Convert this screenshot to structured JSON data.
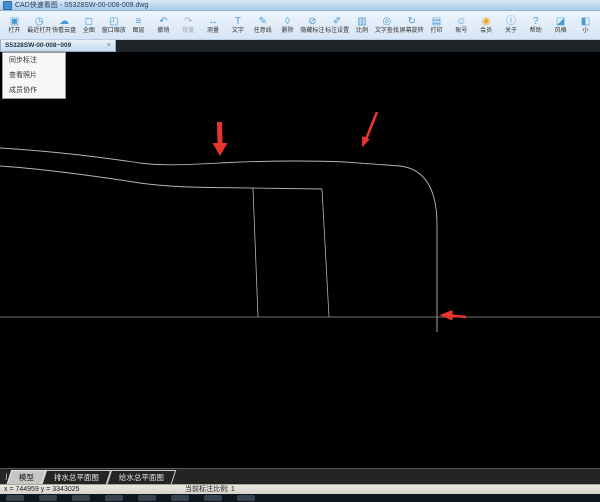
{
  "window": {
    "title": "CAD快速看图 - S5328SW-00-008-009.dwg"
  },
  "toolbar": {
    "items": [
      {
        "name": "open",
        "label": "打开",
        "glyph": "▣"
      },
      {
        "name": "recent-open",
        "label": "最近打开",
        "glyph": "◷"
      },
      {
        "name": "cloud-drive",
        "label": "快看云盘",
        "glyph": "☁"
      },
      {
        "name": "full-view",
        "label": "全图",
        "glyph": "◻"
      },
      {
        "name": "window-zoom",
        "label": "窗口缩放",
        "glyph": "◰"
      },
      {
        "name": "layers",
        "label": "图层",
        "glyph": "≡"
      },
      {
        "name": "undo",
        "label": "撤销",
        "glyph": "↶"
      },
      {
        "name": "redo",
        "label": "恢复",
        "glyph": "↷",
        "disabled": true
      },
      {
        "name": "measure",
        "label": "测量",
        "glyph": "↔"
      },
      {
        "name": "text",
        "label": "文字",
        "glyph": "T"
      },
      {
        "name": "free-line",
        "label": "任意线",
        "glyph": "✎"
      },
      {
        "name": "delete",
        "label": "删除",
        "glyph": "◊"
      },
      {
        "name": "hide-annotation",
        "label": "隐藏标注",
        "glyph": "⊘"
      },
      {
        "name": "annotation-settings",
        "label": "标注设置",
        "glyph": "✐"
      },
      {
        "name": "scale",
        "label": "比例",
        "glyph": "▥"
      },
      {
        "name": "text-search",
        "label": "文字查找",
        "glyph": "◎"
      },
      {
        "name": "screen-rotate",
        "label": "屏幕旋转",
        "glyph": "↻"
      },
      {
        "name": "print",
        "label": "打印",
        "glyph": "▤"
      },
      {
        "name": "account",
        "label": "账号",
        "glyph": "☺"
      },
      {
        "name": "vip",
        "label": "会员",
        "glyph": "◉",
        "color": "#f0a335"
      },
      {
        "name": "about",
        "label": "关于",
        "glyph": "ⓘ"
      },
      {
        "name": "help",
        "label": "帮助",
        "glyph": "?"
      },
      {
        "name": "style",
        "label": "风格",
        "glyph": "◪"
      },
      {
        "name": "mini-tools",
        "label": "小",
        "glyph": "◧"
      }
    ]
  },
  "doc_tab": {
    "label": "S5328SW-00-008~009",
    "close_glyph": "×"
  },
  "context_menu": {
    "items": [
      {
        "name": "sync-annotation",
        "label": "同步标注"
      },
      {
        "name": "view-photos",
        "label": "查看照片"
      },
      {
        "name": "member-collaboration",
        "label": "成员协作"
      }
    ]
  },
  "canvas": {
    "annotations": [
      "red-down-arrow",
      "red-down-left-arrow",
      "red-left-arrow"
    ]
  },
  "sheet_tabs": {
    "lead_glyph": "\\",
    "active_index": 0,
    "items": [
      {
        "name": "model",
        "label": "模型"
      },
      {
        "name": "drainage-plan",
        "label": "排水总平面图"
      },
      {
        "name": "water-supply-plan",
        "label": "给水总平面图"
      }
    ]
  },
  "status_bar": {
    "coords": "x = 744959    y = 3343025",
    "scale_label": "当前标注比例: 1"
  },
  "colors": {
    "accent_blue": "#4a9ad4",
    "vip_orange": "#f0a335",
    "arrow_red": "#e8352e",
    "line_gray": "#b4b4b4",
    "line_gray_dim": "#989898"
  }
}
